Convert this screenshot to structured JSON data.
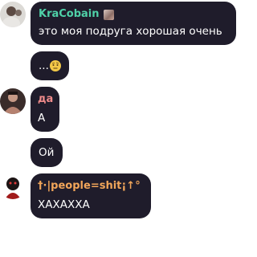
{
  "messages": [
    {
      "author": "KraCobain",
      "author_color": "#4fd1a8",
      "text": "это моя подруга хорошая очень"
    },
    {
      "text": "..."
    },
    {
      "author": "да",
      "author_color": "#ef8b8b",
      "text": "А"
    },
    {
      "text": "Ой"
    },
    {
      "author": "†·|people=shit¡↑°",
      "author_color": "#f2a65a",
      "text": "ХАХАХХА"
    }
  ],
  "icons": {
    "author_badge": "photo-badge-icon",
    "reaction_emoji": "face-with-raised-eyebrow-emoji"
  }
}
